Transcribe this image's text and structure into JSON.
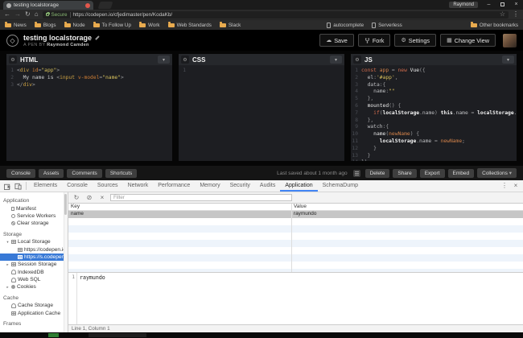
{
  "browser": {
    "tab_title": "testing localstorage",
    "window_user": "Raymond",
    "address": {
      "secure_label": "Secure",
      "url": "https://codepen.io/cfjedimaster/pen/KodaKb/"
    },
    "bookmarks": {
      "folders": [
        {
          "label": "News"
        },
        {
          "label": "Blogs"
        },
        {
          "label": "Node"
        },
        {
          "label": "To Follow Up"
        },
        {
          "label": "Work"
        },
        {
          "label": "Web Standards"
        },
        {
          "label": "Slack"
        }
      ],
      "favicons": [
        {
          "color": "#c2563a"
        },
        {
          "color": "#3d9b49"
        },
        {
          "color": "#e8953c"
        },
        {
          "color": "#3b6fd4"
        },
        {
          "color": "#4caf50"
        },
        {
          "color": "#7aa0c4"
        },
        {
          "color": "#555555",
          "cls": "round"
        },
        {
          "color": "#333333"
        }
      ],
      "pages": [
        {
          "label": "autocomplete"
        },
        {
          "label": "Serverless"
        }
      ],
      "other_label": "Other bookmarks"
    }
  },
  "codepen": {
    "pen_title": "testing localstorage",
    "byline_prefix": "A PEN BY",
    "author": "Raymond Camden",
    "actions": [
      {
        "label": "Save"
      },
      {
        "label": "Fork"
      },
      {
        "label": "Settings"
      },
      {
        "label": "Change View"
      }
    ],
    "editors": [
      {
        "title": "HTML",
        "code": [
          [
            [
              "pn",
              "<"
            ],
            [
              "tg",
              "div"
            ],
            [
              "pn",
              " "
            ],
            [
              "at",
              "id"
            ],
            [
              "pn",
              "="
            ],
            [
              "st",
              "\"app\""
            ],
            [
              "pn",
              ">"
            ]
          ],
          [
            [
              "tx",
              "  My name is "
            ],
            [
              "pn",
              "<"
            ],
            [
              "tg",
              "input"
            ],
            [
              "pn",
              " "
            ],
            [
              "at",
              "v-model"
            ],
            [
              "pn",
              "="
            ],
            [
              "st",
              "\"name\""
            ],
            [
              "pn",
              ">"
            ]
          ],
          [
            [
              "pn",
              "</"
            ],
            [
              "tg",
              "div"
            ],
            [
              "pn",
              ">"
            ]
          ]
        ]
      },
      {
        "title": "CSS",
        "code": [
          []
        ]
      },
      {
        "title": "JS",
        "code": [
          [
            [
              "kw",
              "const "
            ],
            [
              "vo",
              "app"
            ],
            [
              "pn",
              " = "
            ],
            [
              "kw",
              "new "
            ],
            [
              "fn",
              "Vue"
            ],
            [
              "pn",
              "({"
            ]
          ],
          [
            [
              "pn",
              "  "
            ],
            [
              "pr",
              "el"
            ],
            [
              "pn",
              ":"
            ],
            [
              "st",
              "'#app'"
            ],
            [
              "pn",
              ","
            ]
          ],
          [
            [
              "pn",
              "  "
            ],
            [
              "pr",
              "data"
            ],
            [
              "pn",
              ":{"
            ]
          ],
          [
            [
              "pn",
              "    "
            ],
            [
              "pr",
              "name"
            ],
            [
              "pn",
              ":"
            ],
            [
              "st",
              "\"\""
            ]
          ],
          [
            [
              "pn",
              "  },"
            ]
          ],
          [
            [
              "pn",
              "  "
            ],
            [
              "fn",
              "mounted"
            ],
            [
              "pn",
              "() {"
            ]
          ],
          [
            [
              "pn",
              "    "
            ],
            [
              "kw",
              "if"
            ],
            [
              "pn",
              "("
            ],
            [
              "bd",
              "localStorage"
            ],
            [
              "pn",
              "."
            ],
            [
              "pr",
              "name"
            ],
            [
              "pn",
              ") "
            ],
            [
              "bd",
              "this"
            ],
            [
              "pn",
              "."
            ],
            [
              "pr",
              "name"
            ],
            [
              "pn",
              " = "
            ],
            [
              "bd",
              "localStorage"
            ],
            [
              "pn",
              "."
            ],
            [
              "pr",
              "name"
            ],
            [
              "pn",
              ";"
            ]
          ],
          [
            [
              "pn",
              "  },"
            ]
          ],
          [
            [
              "pn",
              "  "
            ],
            [
              "pr",
              "watch"
            ],
            [
              "pn",
              ":{"
            ]
          ],
          [
            [
              "pn",
              "    "
            ],
            [
              "fn",
              "name"
            ],
            [
              "pn",
              "("
            ],
            [
              "vo",
              "newName"
            ],
            [
              "pn",
              ") {"
            ]
          ],
          [
            [
              "pn",
              "      "
            ],
            [
              "bd",
              "localStorage"
            ],
            [
              "pn",
              "."
            ],
            [
              "pr",
              "name"
            ],
            [
              "pn",
              " = "
            ],
            [
              "vo",
              "newName"
            ],
            [
              "pn",
              ";"
            ]
          ],
          [
            [
              "pn",
              "    }"
            ]
          ],
          [
            [
              "pn",
              "  }"
            ]
          ],
          [
            [
              "pn",
              "})"
            ]
          ]
        ]
      }
    ],
    "footer": {
      "left_buttons": [
        {
          "label": "Console"
        },
        {
          "label": "Assets"
        },
        {
          "label": "Comments"
        },
        {
          "label": "Shortcuts"
        }
      ],
      "saved_text": "Last saved about 1 month ago",
      "right_buttons": [
        {
          "label": "Delete"
        },
        {
          "label": "Share"
        },
        {
          "label": "Export"
        },
        {
          "label": "Embed"
        },
        {
          "label": "Collections",
          "cls": "has-caret"
        }
      ]
    }
  },
  "devtools": {
    "tabs": [
      {
        "label": "Elements"
      },
      {
        "label": "Console"
      },
      {
        "label": "Sources"
      },
      {
        "label": "Network"
      },
      {
        "label": "Performance"
      },
      {
        "label": "Memory"
      },
      {
        "label": "Security"
      },
      {
        "label": "Audits"
      },
      {
        "label": "Application",
        "cls": "active"
      },
      {
        "label": "SchemaDump"
      }
    ],
    "sidebar_items": [
      {
        "cls": "header",
        "label": "Application"
      },
      {
        "cls": "item",
        "icon": "file",
        "label": "Manifest"
      },
      {
        "cls": "item",
        "icon": "gear",
        "label": "Service Workers"
      },
      {
        "cls": "item",
        "icon": "clear",
        "label": "Clear storage"
      },
      {
        "cls": "header",
        "label": "Storage"
      },
      {
        "cls": "item",
        "icon": "table",
        "label": "Local Storage",
        "arrow": "▾"
      },
      {
        "cls": "item child",
        "icon": "table",
        "label": "https://codepen.io"
      },
      {
        "cls": "item child selected",
        "icon": "table",
        "label": "https://s.codepen.io"
      },
      {
        "cls": "item",
        "icon": "table",
        "label": "Session Storage",
        "arrow": "▸"
      },
      {
        "cls": "item",
        "icon": "db",
        "label": "IndexedDB"
      },
      {
        "cls": "item",
        "icon": "db",
        "label": "Web SQL"
      },
      {
        "cls": "item",
        "icon": "cookie",
        "label": "Cookies",
        "arrow": "▸"
      },
      {
        "cls": "header",
        "label": "Cache"
      },
      {
        "cls": "item",
        "icon": "db",
        "label": "Cache Storage"
      },
      {
        "cls": "item",
        "icon": "table",
        "label": "Application Cache"
      },
      {
        "cls": "header",
        "label": "Frames"
      }
    ],
    "toolbar": {
      "filter_placeholder": "Filter"
    },
    "storage_table": {
      "columns": [
        "Key",
        "Value"
      ],
      "rows": [
        {
          "key": "name",
          "value": "raymundo",
          "cls": "selected"
        }
      ]
    },
    "preview": {
      "line_number": "1",
      "text": "raymundo"
    },
    "status_bar": "Line 1, Column 1"
  },
  "colors": {
    "devtools_accent": "#4285f4",
    "sidebar_selected": "#3879d6",
    "secure_green": "#8ab973",
    "tab_close_red": "#e2574c",
    "bookmark_folder": "#e9ab4e"
  }
}
